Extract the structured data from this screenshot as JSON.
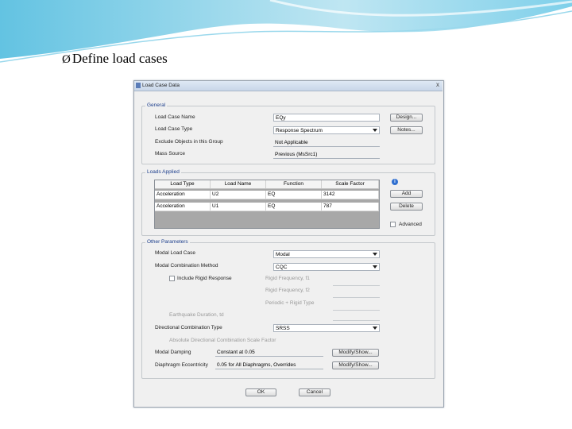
{
  "slide": {
    "title": "Define load cases",
    "bullet": "Ø"
  },
  "dialog": {
    "title": "Load Case Data",
    "close": "x",
    "general": {
      "label": "General",
      "name_label": "Load Case Name",
      "name_value": "EQy",
      "design_button": "Design...",
      "type_label": "Load Case Type",
      "type_value": "Response Spectrum",
      "notes_button": "Notes...",
      "exclude_label": "Exclude Objects in this Group",
      "exclude_value": "Not Applicable",
      "mass_label": "Mass Source",
      "mass_value": "Previous (MsSrc1)"
    },
    "loads": {
      "label": "Loads Applied",
      "columns": [
        "Load Type",
        "Load Name",
        "Function",
        "Scale Factor"
      ],
      "rows": [
        [
          "Acceleration",
          "U2",
          "EQ",
          "3142"
        ],
        [
          "Acceleration",
          "U1",
          "EQ",
          "787"
        ]
      ],
      "add_button": "Add",
      "delete_button": "Delete",
      "advanced_label": "Advanced"
    },
    "other": {
      "label": "Other Parameters",
      "modal_case_label": "Modal Load Case",
      "modal_case_value": "Modal",
      "modal_comb_label": "Modal Combination Method",
      "modal_comb_value": "CQC",
      "include_rigid_label": "Include Rigid Response",
      "rigid_f1": "Rigid Frequency, f1",
      "rigid_f2": "Rigid Frequency, f2",
      "periodic_rigid": "Periodic + Rigid Type",
      "eq_duration": "Earthquake Duration, td",
      "dir_comb_label": "Directional Combination Type",
      "dir_comb_value": "SRSS",
      "abs_dir_label": "Absolute Directional Combination Scale Factor",
      "damping_label": "Modal Damping",
      "damping_value": "Constant at 0.05",
      "damping_button": "Modify/Show...",
      "eccentricity_label": "Diaphragm Eccentricity",
      "eccentricity_value": "0.05 for All Diaphragms, Overrides",
      "eccentricity_button": "Modify/Show..."
    },
    "ok_button": "OK",
    "cancel_button": "Cancel"
  }
}
